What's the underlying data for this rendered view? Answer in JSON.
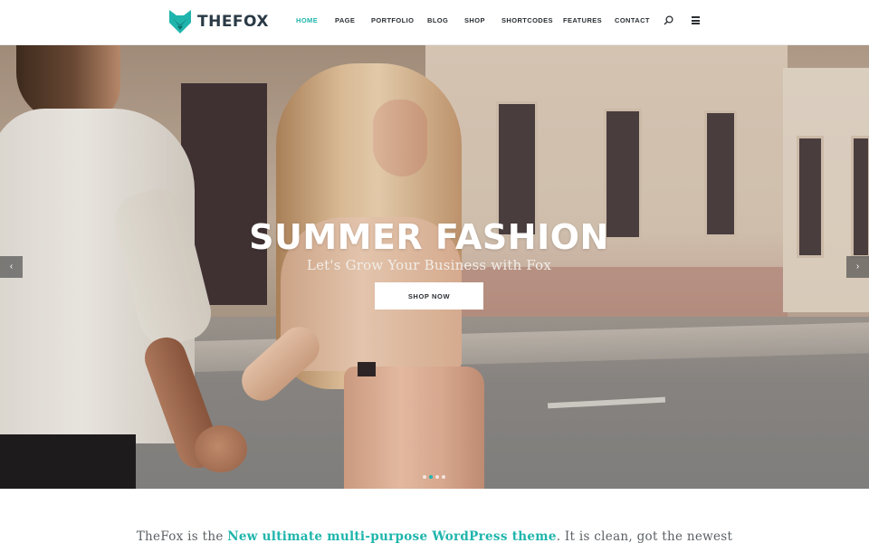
{
  "brand": {
    "name": "THEFOX",
    "logo_icon": "fox-head-icon",
    "accent_color": "#1fb5ac"
  },
  "nav": {
    "items": [
      {
        "label": "HOME",
        "active": true
      },
      {
        "label": "PAGE",
        "active": false
      },
      {
        "label": "PORTFOLIO",
        "active": false
      },
      {
        "label": "BLOG",
        "active": false
      },
      {
        "label": "SHOP",
        "active": false
      },
      {
        "label": "SHORTCODES",
        "active": false
      },
      {
        "label": "FEATURES",
        "active": false
      },
      {
        "label": "CONTACT",
        "active": false
      }
    ],
    "search_icon": "search-icon",
    "menu_icon": "hamburger-menu-icon"
  },
  "hero": {
    "title": "SUMMER FASHION",
    "subtitle": "Let's Grow Your Business with Fox",
    "button_label": "SHOP NOW",
    "prev_icon": "chevron-left-icon",
    "next_icon": "chevron-right-icon",
    "prev_glyph": "‹",
    "next_glyph": "›",
    "slide_count": 4,
    "active_slide": 1
  },
  "intro": {
    "text_before": "TheFox is the ",
    "highlight": "New ultimate multi-purpose WordPress theme",
    "text_after": ". It is clean, got the newest"
  }
}
